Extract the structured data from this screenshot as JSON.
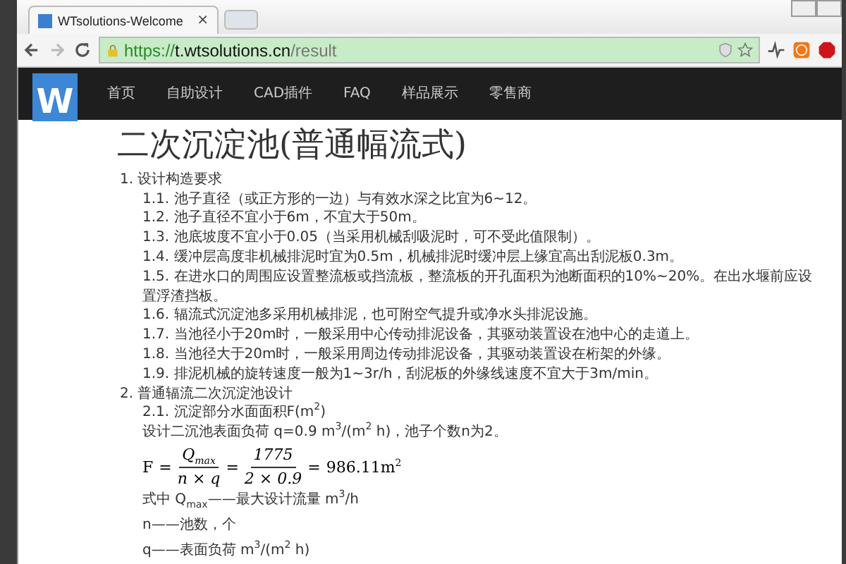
{
  "browser": {
    "tab": {
      "title": "WTsolutions-Welcome",
      "close": "×"
    },
    "address": {
      "scheme": "https://",
      "host": "t.wtsolutions.cn",
      "path": "/result",
      "secure": true
    }
  },
  "site": {
    "logo": "W",
    "nav": [
      {
        "label": "首页"
      },
      {
        "label": "自助设计"
      },
      {
        "label": "CAD插件"
      },
      {
        "label": "FAQ"
      },
      {
        "label": "样品展示"
      },
      {
        "label": "零售商"
      }
    ]
  },
  "page": {
    "title": "二次沉淀池(普通幅流式)",
    "sections": [
      {
        "heading": "1. 设计构造要求",
        "items": [
          "1.1. 池子直径（或正方形的一边）与有效水深之比宜为6~12。",
          "1.2. 池子直径不宜小于6m，不宜大于50m。",
          "1.3. 池底坡度不宜小于0.05（当采用机械刮吸泥时，可不受此值限制）。",
          "1.4. 缓冲层高度非机械排泥时宜为0.5m，机械排泥时缓冲层上缘宜高出刮泥板0.3m。",
          "1.5. 在进水口的周围应设置整流板或挡流板，整流板的开孔面积为池断面积的10%~20%。在出水堰前应设置浮渣挡板。",
          "1.6. 辐流式沉淀池多采用机械排泥，也可附空气提升或净水头排泥设施。",
          "1.7. 当池径小于20m时，一般采用中心传动排泥设备，其驱动装置设在池中心的走道上。",
          "1.8. 当池径大于20m时，一般采用周边传动排泥设备，其驱动装置设在桁架的外缘。",
          "1.9. 排泥机械的旋转速度一般为1~3r/h，刮泥板的外缘线速度不宜大于3m/min。"
        ]
      },
      {
        "heading": "2. 普通辐流二次沉淀池设计",
        "items": [
          "2.1. 沉淀部分水面面积F(m$^{2}$)",
          "设计二沉池表面负荷 q=0.9 m$^{3}$/(m$^{2}$ h)，池子个数n为2。"
        ]
      }
    ],
    "formula": [
      {
        "kind": "text",
        "text": "F"
      },
      {
        "kind": "text",
        "text": "="
      },
      {
        "kind": "fraction",
        "num": "Q$_{max}$",
        "den": "n × q"
      },
      {
        "kind": "text",
        "text": "="
      },
      {
        "kind": "fraction",
        "num": "1775",
        "den": "2 × 0.9"
      },
      {
        "kind": "text",
        "text": "="
      },
      {
        "kind": "text",
        "text": "986.11m$^{2}$"
      }
    ],
    "notes": [
      "式中 Q$_{max}$——最大设计流量 m$^{3}$/h",
      "n——池数，个",
      "q——表面负荷 m$^{3}$/(m$^{2}$ h)"
    ]
  }
}
